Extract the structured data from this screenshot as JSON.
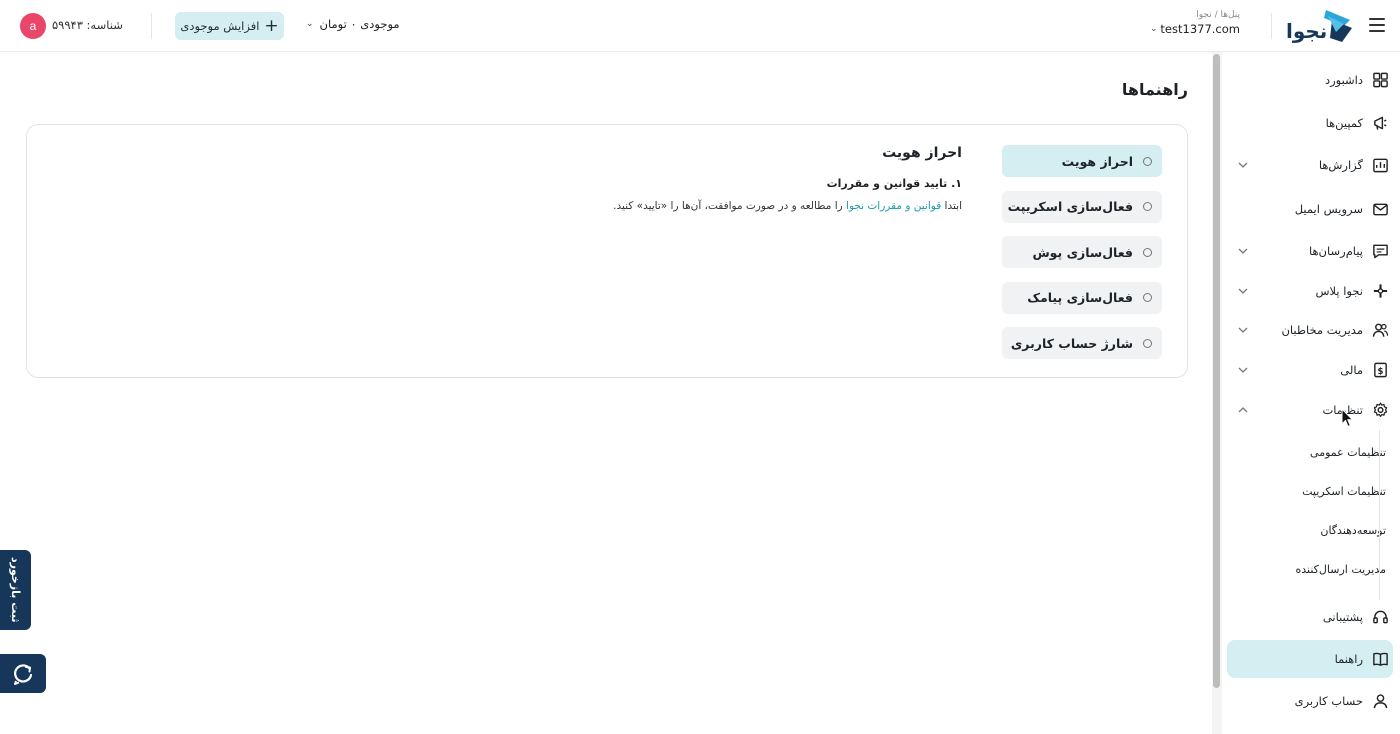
{
  "header": {
    "avatar_letter": "a",
    "user_id": "شناسه: ۵۹۹۴۳",
    "topup_label": "افزایش موجودی",
    "balance": "موجودی ۰ تومان",
    "panel_breadcrumb": "پنل‌ها / نجوا",
    "panel_domain": "test1377.com",
    "logo_text": "نجوا"
  },
  "main": {
    "title": "راهنماها",
    "guides": [
      {
        "label": "احراز هویت",
        "active": true
      },
      {
        "label": "فعال‌سازی اسکریپت",
        "active": false
      },
      {
        "label": "فعال‌سازی پوش",
        "active": false
      },
      {
        "label": "فعال‌سازی پیامک",
        "active": false
      },
      {
        "label": "شارژ حساب کاربری",
        "active": false
      }
    ],
    "content": {
      "title": "احراز هویت",
      "step": "۱. تایید قوانین و مقررات",
      "text_before": "ابتدا ",
      "link": "قوانین و مقررات نجوا",
      "text_after": " را مطالعه و در صورت موافقت، آن‌ها را «تایید» کنید."
    }
  },
  "sidebar": {
    "items": [
      {
        "label": "داشبورد",
        "icon": "dashboard-icon",
        "has_arrow": false
      },
      {
        "label": "کمپین‌ها",
        "icon": "megaphone-icon",
        "has_arrow": false
      },
      {
        "label": "گزارش‌ها",
        "icon": "report-icon",
        "has_arrow": true
      },
      {
        "label": "سرویس ایمیل",
        "icon": "mail-icon",
        "has_arrow": false
      },
      {
        "label": "پیام‌رسان‌ها",
        "icon": "messenger-icon",
        "has_arrow": true
      },
      {
        "label": "نجوا پلاس",
        "icon": "plus-icon",
        "has_arrow": true
      },
      {
        "label": "مدیریت مخاطبان",
        "icon": "users-icon",
        "has_arrow": true
      },
      {
        "label": "مالی",
        "icon": "finance-icon",
        "has_arrow": true
      },
      {
        "label": "تنظیمات",
        "icon": "gear-icon",
        "has_arrow": true,
        "expanded": true
      }
    ],
    "settings_sub": [
      {
        "label": "تنظیمات عمومی"
      },
      {
        "label": "تنظیمات اسکریپت"
      },
      {
        "label": "توسعه‌دهندگان"
      },
      {
        "label": "مدیریت ارسال‌کننده"
      }
    ],
    "bottom_items": [
      {
        "label": "پشتیبانی",
        "icon": "headset-icon"
      },
      {
        "label": "راهنما",
        "icon": "book-icon",
        "active": true
      },
      {
        "label": "حساب کاربری",
        "icon": "user-icon"
      }
    ]
  },
  "widgets": {
    "feedback_label": "ثبت بازخورد"
  },
  "colors": {
    "accent": "#d4eef2",
    "link": "#1a9dad",
    "brand_dark": "#16365a",
    "avatar": "#e8476a"
  }
}
